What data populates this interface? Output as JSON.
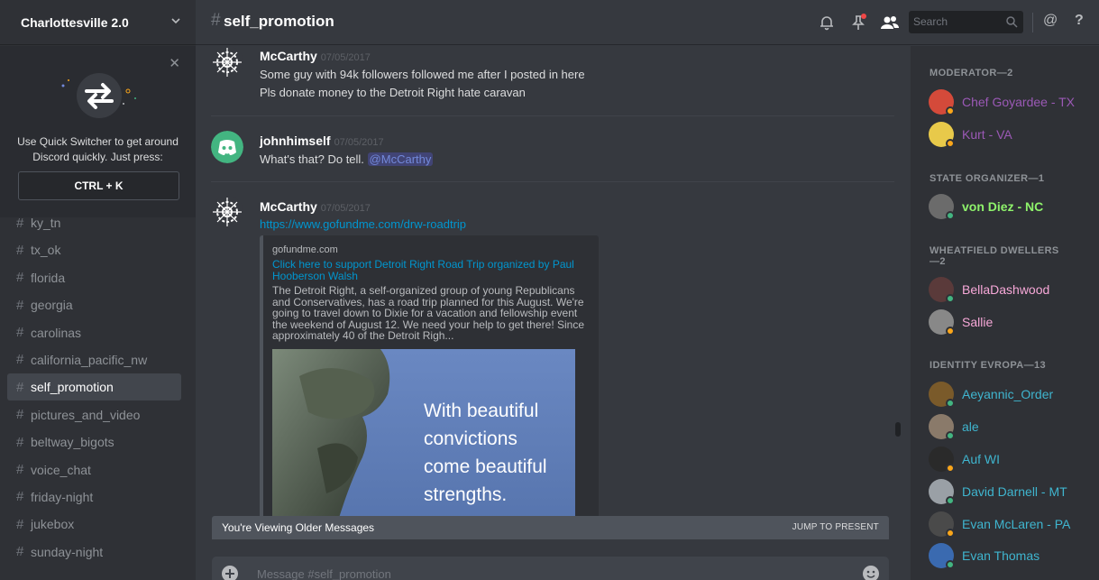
{
  "server": {
    "name": "Charlottesville 2.0"
  },
  "quick_switcher": {
    "text_line1": "Use Quick Switcher to get around",
    "text_line2": "Discord quickly. Just press:",
    "shortcut": "CTRL + K"
  },
  "channels": [
    {
      "name": "ky_tn",
      "active": false
    },
    {
      "name": "tx_ok",
      "active": false
    },
    {
      "name": "florida",
      "active": false
    },
    {
      "name": "georgia",
      "active": false
    },
    {
      "name": "carolinas",
      "active": false
    },
    {
      "name": "california_pacific_nw",
      "active": false
    },
    {
      "name": "self_promotion",
      "active": true
    },
    {
      "name": "pictures_and_video",
      "active": false
    },
    {
      "name": "beltway_bigots",
      "active": false
    },
    {
      "name": "voice_chat",
      "active": false
    },
    {
      "name": "friday-night",
      "active": false
    },
    {
      "name": "jukebox",
      "active": false
    },
    {
      "name": "sunday-night",
      "active": false
    }
  ],
  "header": {
    "hash": "#",
    "channel": "self_promotion",
    "search_placeholder": "Search",
    "at": "@",
    "help": "?"
  },
  "messages": [
    {
      "author": "McCarthy",
      "timestamp": "07/05/2017",
      "lines": [
        "Some guy with 94k followers followed me after I posted in here",
        "Pls donate money to the Detroit Right hate caravan"
      ]
    },
    {
      "author": "johnhimself",
      "timestamp": "07/05/2017",
      "text": "What's that? Do tell.",
      "mention": "@McCarthy"
    },
    {
      "author": "McCarthy",
      "timestamp": "07/05/2017",
      "link": "https://www.gofundme.com/drw-roadtrip"
    }
  ],
  "embed": {
    "provider": "gofundme.com",
    "title": "Click here to support Detroit Right Road Trip organized by Paul Hooberson Walsh",
    "description": "The Detroit Right, a self-organized group of young Republicans and Conservatives, has a road trip planned for this August. We're going to travel down to Dixie for a vacation and fellowship event the weekend of August 12. We need your help to get there! Since approximately 40 of the Detroit Righ...",
    "image_text": [
      "With beautiful",
      "convictions",
      "come beautiful",
      "strengths."
    ]
  },
  "older_bar": {
    "text": "You're Viewing Older Messages",
    "jump": "JUMP TO PRESENT"
  },
  "input": {
    "placeholder": "Message #self_promotion"
  },
  "member_groups": [
    {
      "label": "MODERATOR—2",
      "members": [
        {
          "name": "Chef Goyardee - TX",
          "color": "#9b59b6",
          "status": "#faa61a",
          "avatar": "#d44a3a"
        },
        {
          "name": "Kurt - VA",
          "color": "#9b59b6",
          "status": "#faa61a",
          "avatar": "#e8c94a"
        }
      ]
    },
    {
      "label": "STATE ORGANIZER—1",
      "members": [
        {
          "name": "von Diez - NC",
          "color": "#8ef26b",
          "status": "#43b581",
          "avatar": "#6b6b6b"
        }
      ]
    },
    {
      "label": "WHEATFIELD DWELLERS—2",
      "members": [
        {
          "name": "BellaDashwood",
          "color": "#f7a8d8",
          "status": "#43b581",
          "avatar": "#5a3a3a"
        },
        {
          "name": "Sallie",
          "color": "#f7a8d8",
          "status": "#faa61a",
          "avatar": "#888888"
        }
      ]
    },
    {
      "label": "IDENTITY EVROPA—13",
      "members": [
        {
          "name": "Aeyannic_Order",
          "color": "#3fb5cf",
          "status": "#43b581",
          "avatar": "#7a5a2a"
        },
        {
          "name": "ale",
          "color": "#3fb5cf",
          "status": "#43b581",
          "avatar": "#8a7a6a"
        },
        {
          "name": "Auf WI",
          "color": "#3fb5cf",
          "status": "#faa61a",
          "avatar": "#2a2a2a"
        },
        {
          "name": "David Darnell - MT",
          "color": "#3fb5cf",
          "status": "#43b581",
          "avatar": "#9aa0a6"
        },
        {
          "name": "Evan McLaren - PA",
          "color": "#3fb5cf",
          "status": "#faa61a",
          "avatar": "#4a4a4a"
        },
        {
          "name": "Evan Thomas",
          "color": "#3fb5cf",
          "status": "#43b581",
          "avatar": "#3a6ab0"
        }
      ]
    }
  ]
}
